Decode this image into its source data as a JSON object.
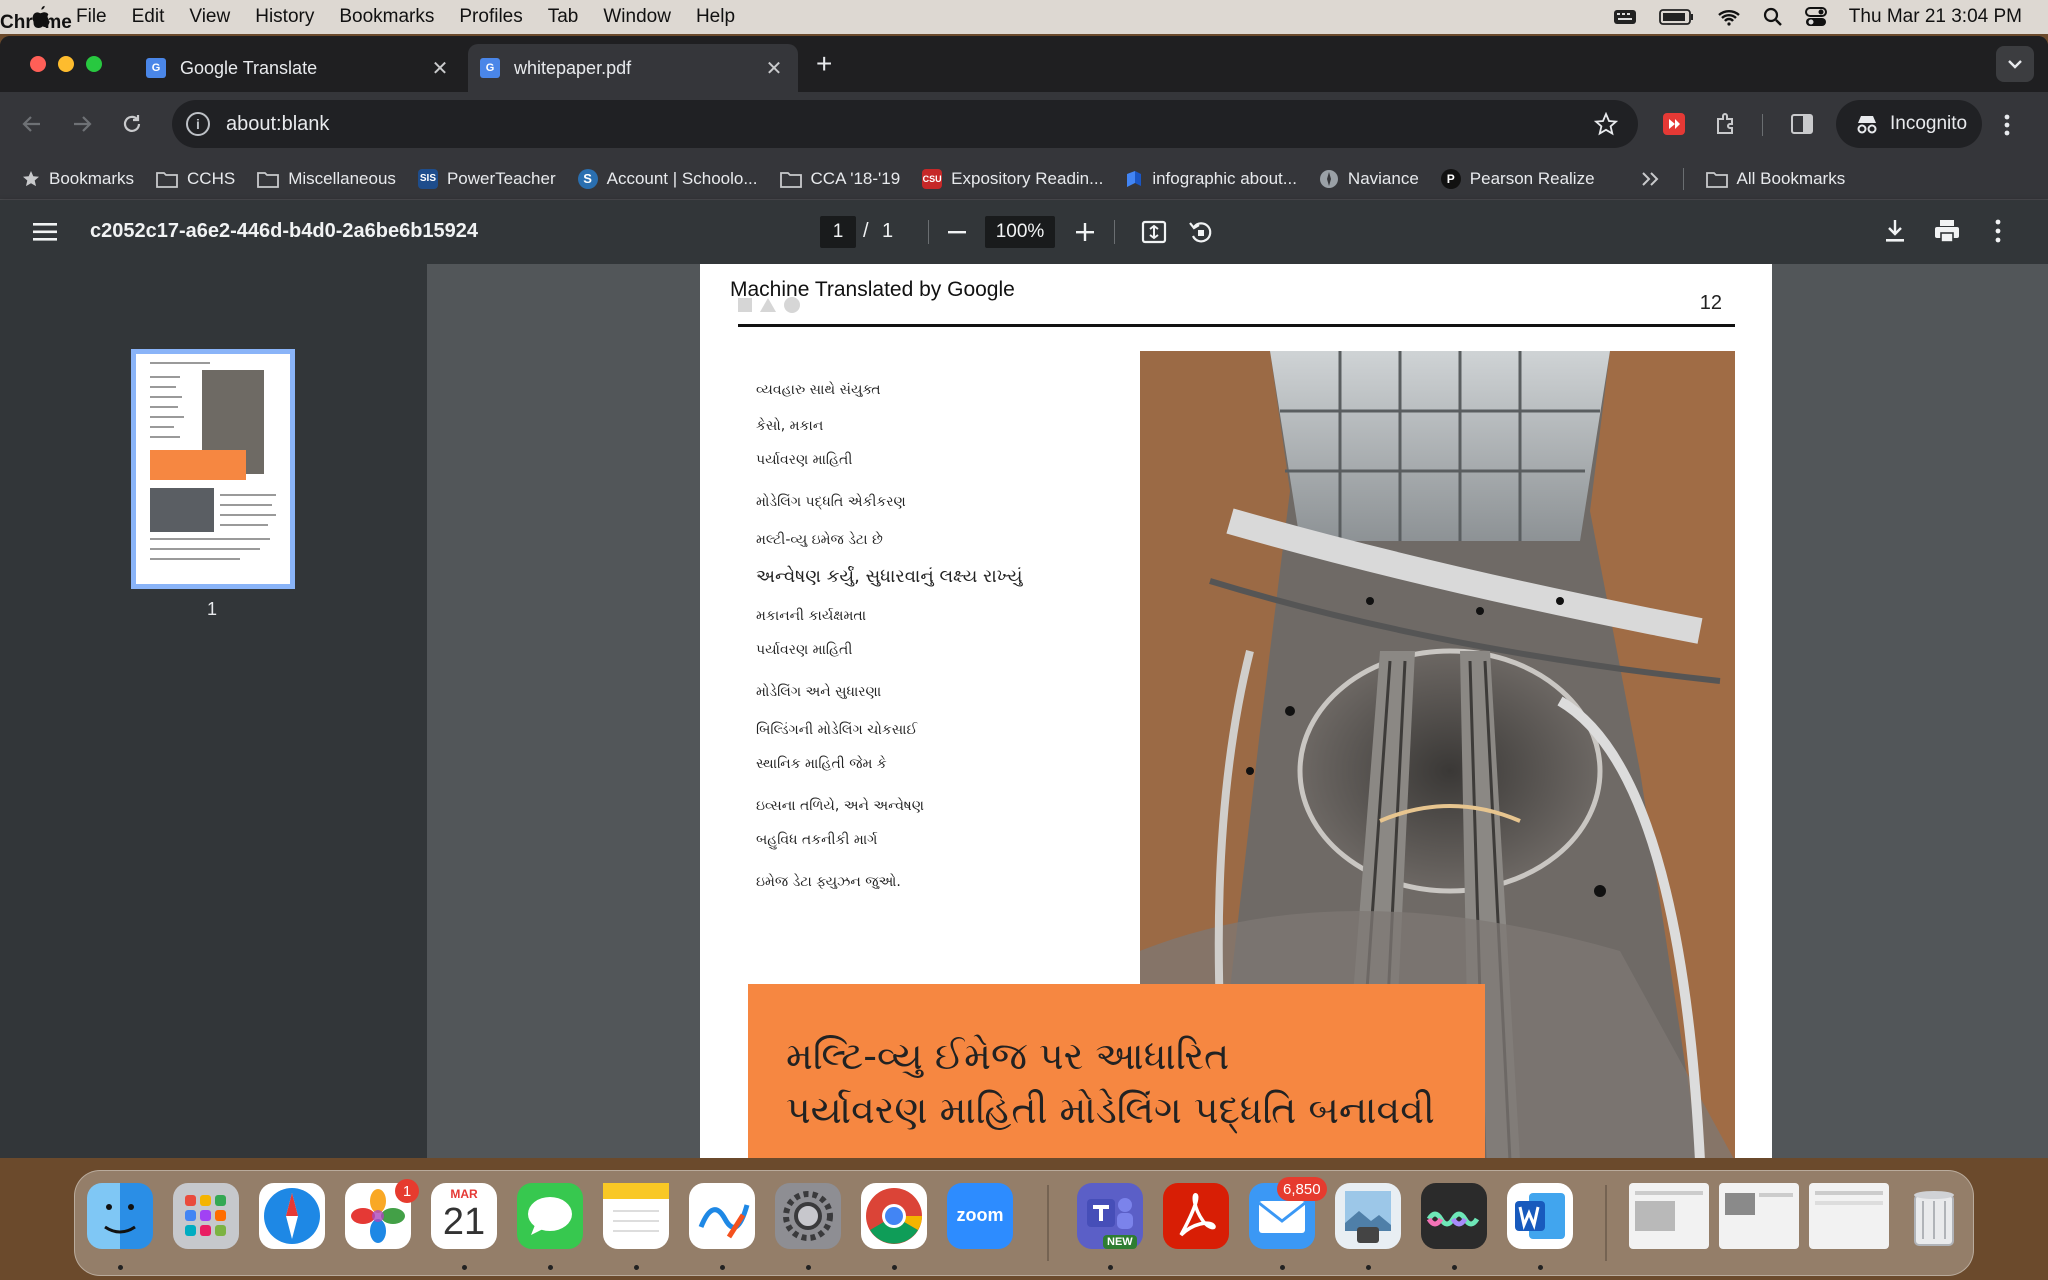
{
  "menubar": {
    "items": [
      "Chrome",
      "File",
      "Edit",
      "View",
      "History",
      "Bookmarks",
      "Profiles",
      "Tab",
      "Window",
      "Help"
    ],
    "datetime": "Thu Mar 21  3:04 PM"
  },
  "tabs": [
    {
      "title": "Google Translate",
      "favicon": "google-translate-icon"
    },
    {
      "title": "whitepaper.pdf",
      "favicon": "google-translate-icon"
    }
  ],
  "omnibox": {
    "url": "about:blank"
  },
  "profile": {
    "label": "Incognito"
  },
  "bookmarks": [
    {
      "label": "Bookmarks",
      "icon": "star-icon"
    },
    {
      "label": "CCHS",
      "icon": "folder-icon"
    },
    {
      "label": "Miscellaneous",
      "icon": "folder-icon"
    },
    {
      "label": "PowerTeacher",
      "icon": "powerteacher-icon"
    },
    {
      "label": "Account | Schoolo...",
      "icon": "schoology-icon"
    },
    {
      "label": "CCA '18-'19",
      "icon": "folder-icon"
    },
    {
      "label": "Expository Readin...",
      "icon": "csu-icon"
    },
    {
      "label": "infographic about...",
      "icon": "infographic-icon"
    },
    {
      "label": "Naviance",
      "icon": "naviance-icon"
    },
    {
      "label": "Pearson Realize",
      "icon": "pearson-icon"
    }
  ],
  "all_bookmarks": "All Bookmarks",
  "pdf": {
    "filename": "c2052c17-a6e2-446d-b4d0-2a6be6b15924",
    "page_current": "1",
    "page_separator": "/",
    "page_total": "1",
    "zoom": "100%",
    "thumbnail_label": "1"
  },
  "document": {
    "header": "Machine Translated by Google",
    "page_number": "12",
    "toc": [
      "વ્યવહારુ સાથે સંયુક્ત",
      "કેસો, મકાન",
      "પર્યાવરણ માહિતી",
      "મોડેલિંગ પદ્ધતિ એકીકરણ",
      "મલ્ટી-વ્યુ ઇમેજ ડેટા છે",
      "અન્વેષણ કર્યું, સુધારવાનું લક્ષ્ય રાખ્યું",
      "મકાનની કાર્યક્ષમતા",
      "પર્યાવરણ માહિતી",
      "મોડેલિંગ અને સુધારણા",
      "બિલ્ડિંગની મોડેલિંગ ચોકસાઈ",
      "સ્થાનિક માહિતી જેમ કે",
      "ઇવ્સના તળિયે, અને અન્વેષણ",
      "બહુવિધ તકનીકી માર્ગ",
      "ઇમેજ ડેટા ફ્યુઝન જુઓ."
    ],
    "banner_line1": "મલ્ટિ-વ્યુ ઈમેજ પર આધારિત",
    "banner_line2": "પર્યાવરણ માહિતી મોડેલિંગ પદ્ધતિ બનાવવી",
    "banner_color": "#f68741"
  },
  "dock": {
    "apps": [
      "Finder",
      "Launchpad",
      "Safari",
      "Photos",
      "Calendar",
      "Messages",
      "Notes",
      "Freeform",
      "System Settings",
      "Chrome",
      "Zoom",
      "Teams",
      "Acrobat",
      "Mail",
      "Preview",
      "Wunderbucket",
      "Word"
    ],
    "photos_badge": "1",
    "calendar_month": "MAR",
    "calendar_day": "21",
    "zoom_label": "zoom",
    "teams_label": "NEW",
    "mail_badge": "6,850"
  }
}
